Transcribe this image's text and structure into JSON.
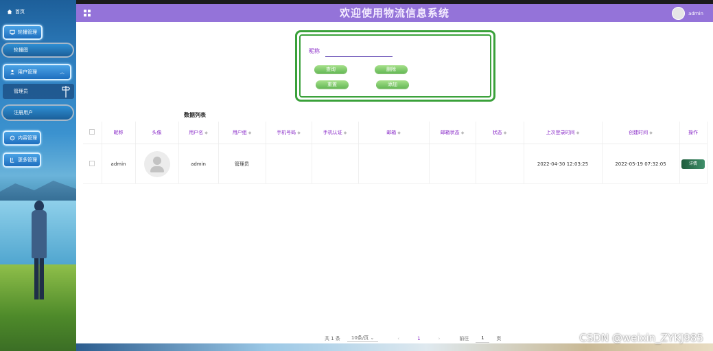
{
  "sidebar": {
    "home_label": "首页",
    "menus": [
      {
        "label": "轮播管理",
        "icon": "monitor-icon"
      },
      {
        "label": "用户管理",
        "icon": "user-icon"
      },
      {
        "label": "内容管理",
        "icon": "chat-icon"
      },
      {
        "label": "更多管理",
        "icon": "grid-icon"
      }
    ],
    "sub_items": {
      "carousel": "轮播图",
      "admin": "管理员",
      "registered": "注册用户"
    }
  },
  "header": {
    "title": "欢迎使用物流信息系统",
    "username": "admin"
  },
  "search": {
    "label": "昵称",
    "value": "",
    "placeholder": "",
    "buttons": {
      "query": "查询",
      "delete": "删除",
      "reset": "重置",
      "add": "添加"
    }
  },
  "table": {
    "title": "数据列表",
    "columns": [
      "昵称",
      "头像",
      "用户名",
      "用户组",
      "手机号码",
      "手机认证",
      "邮箱",
      "邮箱状态",
      "状态",
      "上次登录时间",
      "创建时间",
      "操作"
    ],
    "rows": [
      {
        "nickname": "admin",
        "username": "admin",
        "group": "管理员",
        "phone": "",
        "phone_verified": "",
        "email": "",
        "email_status": "",
        "status": "",
        "last_login": "2022-04-30 12:03:25",
        "created": "2022-05-19 07:32:05",
        "action": "详情"
      }
    ]
  },
  "pagination": {
    "total": "共 1 条",
    "page_size": "10条/页",
    "current_page": "1",
    "goto_label": "前往",
    "goto_value": "1",
    "page_suffix": "页"
  },
  "watermark": "CSDN @weixin_ZYKJ985"
}
